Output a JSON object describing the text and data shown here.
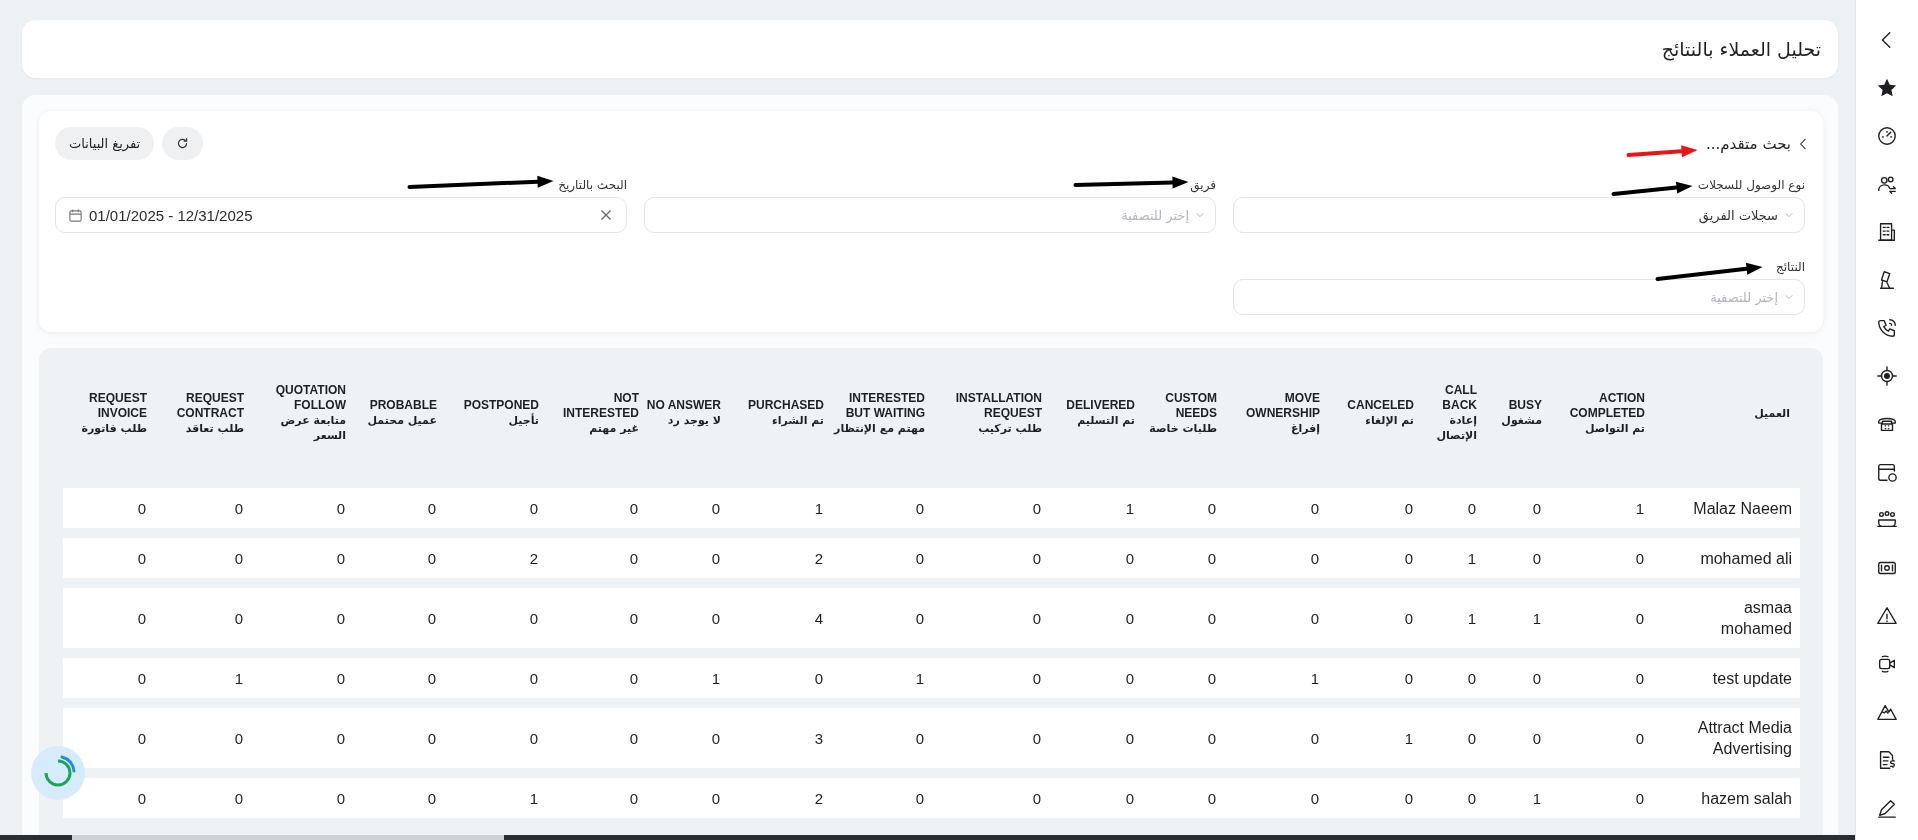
{
  "page_title": "تحليل العملاء بالنتائج",
  "advanced_search": {
    "title": "بحث متقدم...",
    "clear_button": "تفريغ البيانات"
  },
  "filters": [
    {
      "kind": "select",
      "label": "نوع الوصول للسجلات",
      "value": "سجلات الفريق"
    },
    {
      "kind": "select",
      "label": "فريق",
      "placeholder": "إختر للتصفية"
    },
    {
      "kind": "date",
      "label": "البحث بالتاريخ",
      "value": "01/01/2025 - 12/31/2025"
    },
    {
      "kind": "select",
      "label": "النتائج",
      "placeholder": "إختر للتصفية"
    }
  ],
  "table": {
    "columns": [
      {
        "ar": "العميل"
      },
      {
        "en": "ACTION COMPLETED",
        "ar": "تم التواصل"
      },
      {
        "en": "BUSY",
        "ar": "مشغول"
      },
      {
        "en": "CALL BACK",
        "ar": "إعادة الإتصال"
      },
      {
        "en": "CANCELED",
        "ar": "تم الإلغاء"
      },
      {
        "en": "MOVE OWNERSHIP",
        "ar": "إفراغ"
      },
      {
        "en": "CUSTOM NEEDS",
        "ar": "طلبات خاصة"
      },
      {
        "en": "DELIVERED",
        "ar": "تم التسليم"
      },
      {
        "en": "INSTALLATION REQUEST",
        "ar": "طلب تركيب"
      },
      {
        "en": "INTERESTED BUT WAITING",
        "ar": "مهتم مع الإنتظار"
      },
      {
        "en": "PURCHASED",
        "ar": "تم الشراء"
      },
      {
        "en": "NO ANSWER",
        "ar": "لا يوجد رد"
      },
      {
        "en": "NOT INTERESTED",
        "ar": "غير مهتم"
      },
      {
        "en": "POSTPONED",
        "ar": "تأجيل"
      },
      {
        "en": "PROBABLE",
        "ar": "عميل محتمل"
      },
      {
        "en": "QUOTATION FOLLOW",
        "ar": "متابعة عرض السعر"
      },
      {
        "en": "REQUEST CONTRACT",
        "ar": "طلب تعاقد"
      },
      {
        "en": "REQUEST INVOICE",
        "ar": "طلب فاتورة"
      }
    ],
    "rows": [
      {
        "cells": [
          "Malaz Naeem",
          "1",
          "0",
          "0",
          "0",
          "0",
          "0",
          "1",
          "0",
          "0",
          "1",
          "0",
          "0",
          "0",
          "0",
          "0",
          "0",
          "0"
        ]
      },
      {
        "cells": [
          "mohamed ali",
          "0",
          "0",
          "1",
          "0",
          "0",
          "0",
          "0",
          "0",
          "0",
          "2",
          "0",
          "0",
          "2",
          "0",
          "0",
          "0",
          "0"
        ]
      },
      {
        "cells": [
          "asmaa mohamed",
          "0",
          "1",
          "1",
          "0",
          "0",
          "0",
          "0",
          "0",
          "0",
          "4",
          "0",
          "0",
          "0",
          "0",
          "0",
          "0",
          "0"
        ]
      },
      {
        "cells": [
          "test update",
          "0",
          "0",
          "0",
          "0",
          "1",
          "0",
          "0",
          "0",
          "1",
          "0",
          "1",
          "0",
          "0",
          "0",
          "0",
          "1",
          "0"
        ]
      },
      {
        "cells": [
          "Attract Media Advertising",
          "0",
          "0",
          "0",
          "1",
          "0",
          "0",
          "0",
          "0",
          "0",
          "3",
          "0",
          "0",
          "0",
          "0",
          "0",
          "0",
          "0"
        ]
      },
      {
        "cells": [
          "hazem salah",
          "0",
          "1",
          "0",
          "0",
          "0",
          "0",
          "0",
          "0",
          "0",
          "2",
          "0",
          "0",
          "1",
          "0",
          "0",
          "0",
          "0"
        ]
      }
    ]
  }
}
